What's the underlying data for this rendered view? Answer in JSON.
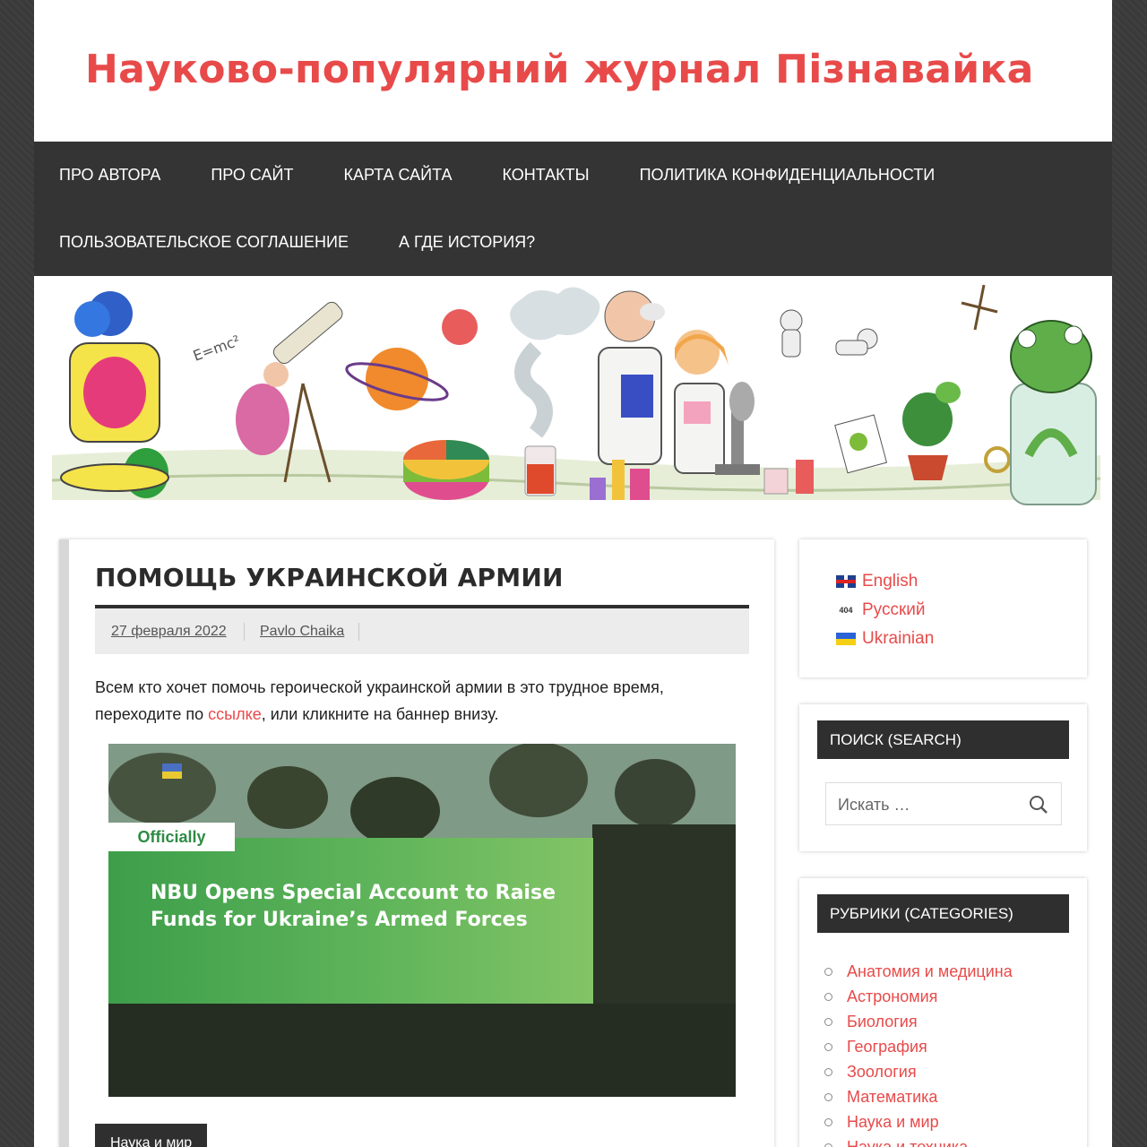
{
  "site": {
    "title": "Науково-популярний журнал Пізнавайка"
  },
  "nav": {
    "row1": [
      "ПРО АВТОРА",
      "ПРО САЙТ",
      "КАРТА САЙТА",
      "КОНТАКТЫ",
      "ПОЛИТИКА КОНФИДЕНЦИАЛЬНОСТИ"
    ],
    "row2": [
      "ПОЛЬЗОВАТЕЛЬСКОЕ СОГЛАШЕНИЕ",
      "А ГДЕ ИСТОРИЯ?"
    ]
  },
  "post": {
    "title": "ПОМОЩЬ УКРАИНСКОЙ АРМИИ",
    "date": "27 февраля 2022",
    "author": "Pavlo Chaika",
    "body_before": "Всем кто хочет помочь героической украинской армии в это трудное время, переходите по ",
    "body_link": "ссылке",
    "body_after": ", или кликните на баннер внизу.",
    "promo": {
      "tag": "Officially",
      "headline": "NBU Opens Special Account to Raise Funds for Ukraine’s Armed Forces"
    },
    "category": "Наука и мир"
  },
  "languages": [
    {
      "label": "English",
      "flag": "gb-flag-icon"
    },
    {
      "label": "Русский",
      "flag": "404-flag-icon"
    },
    {
      "label": "Ukrainian",
      "flag": "ua-flag-icon"
    }
  ],
  "search": {
    "title": "ПОИСК (SEARCH)",
    "placeholder": "Искать …"
  },
  "categories": {
    "title": "РУБРИКИ (CATEGORIES)",
    "items": [
      "Анатомия и медицина",
      "Астрономия",
      "Биология",
      "География",
      "Зоология",
      "Математика",
      "Наука и мир",
      "Наука и техника"
    ]
  },
  "colors": {
    "accent": "#e84a4a",
    "dark": "#343434",
    "promo_green": "#5fb45a"
  }
}
